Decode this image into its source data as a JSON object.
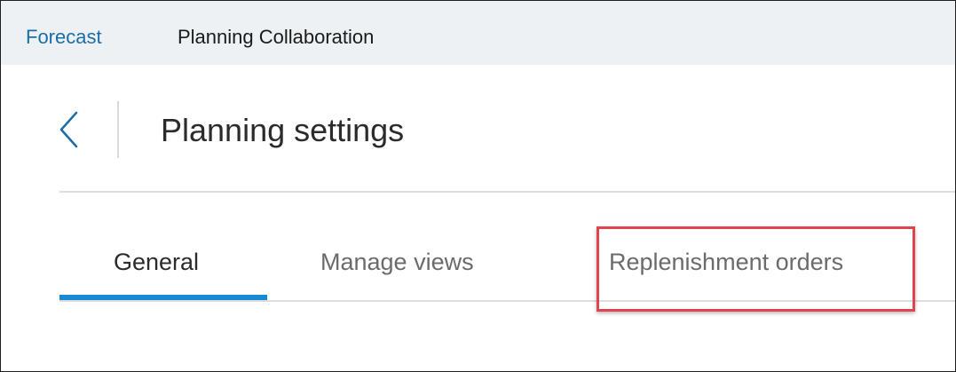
{
  "header": {
    "nav_items": [
      {
        "label": "Forecast"
      },
      {
        "label": "Planning Collaboration"
      }
    ]
  },
  "page": {
    "back_icon": "chevron-left-icon",
    "title": "Planning settings"
  },
  "tabs": [
    {
      "label": "General",
      "selected": true
    },
    {
      "label": "Manage views",
      "selected": false
    },
    {
      "label": "Replenishment orders",
      "selected": false,
      "highlighted": true
    }
  ],
  "colors": {
    "accent": "#1a89d4",
    "link": "#1a6ea8",
    "highlight": "#e0454f",
    "header_background": "#edf1f3"
  }
}
